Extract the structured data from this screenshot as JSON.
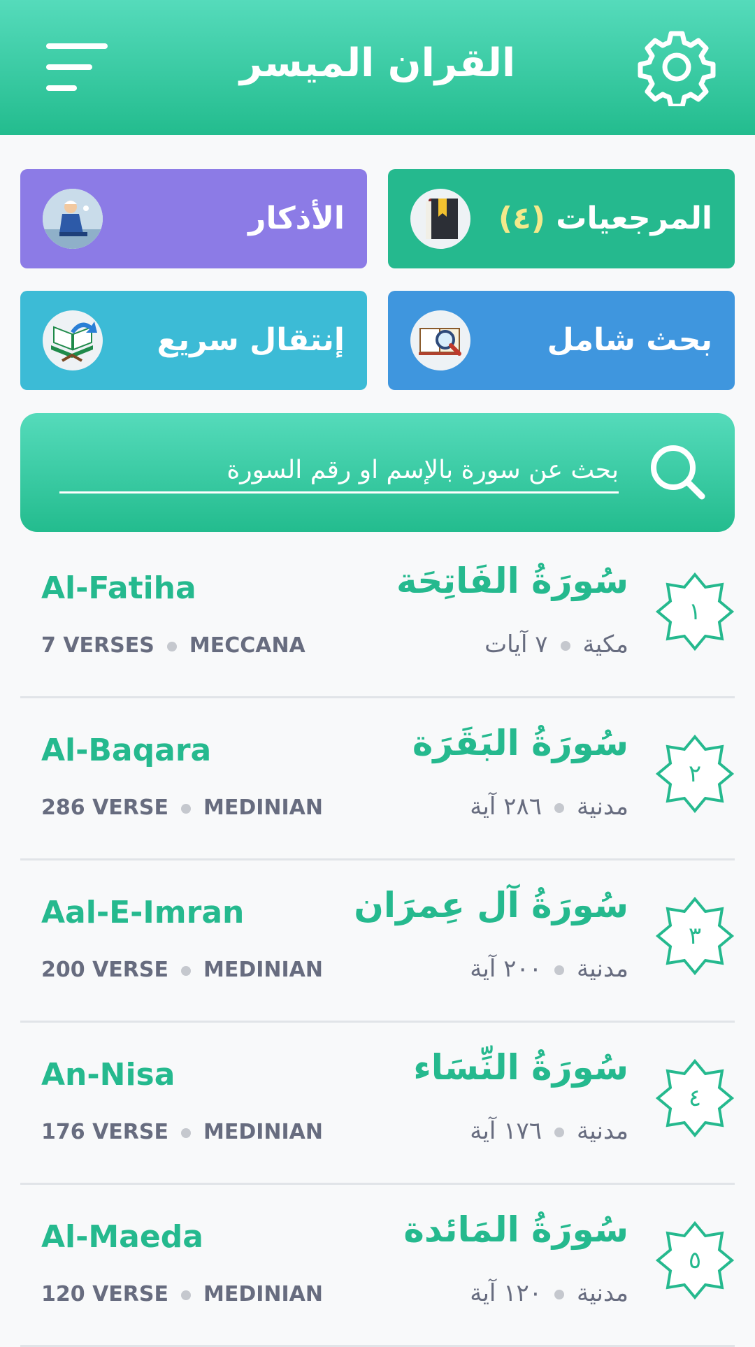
{
  "header": {
    "title": "القران الميسر"
  },
  "tiles": {
    "references": {
      "count": "(٤)",
      "label": "المرجعيات"
    },
    "adhkar": {
      "label": "الأذكار"
    },
    "comprehensive_search": {
      "label": "بحث شامل"
    },
    "quick_jump": {
      "label": "إنتقال سريع"
    }
  },
  "search": {
    "placeholder": "بحث عن سورة بالإسم او رقم السورة"
  },
  "surahs": [
    {
      "number": "١",
      "arabic": "سُورَةُ الفَاتِحَة",
      "english": "Al-Fatiha",
      "verses_en": "7 VERSES",
      "type_en": "MECCANA",
      "type_ar": "مكية",
      "verses_ar": "٧ آيات"
    },
    {
      "number": "٢",
      "arabic": "سُورَةُ البَقَرَة",
      "english": "Al-Baqara",
      "verses_en": "286 VERSE",
      "type_en": "MEDINIAN",
      "type_ar": "مدنية",
      "verses_ar": "٢٨٦ آية"
    },
    {
      "number": "٣",
      "arabic": "سُورَةُ آل عِمرَان",
      "english": "Aal-E-Imran",
      "verses_en": "200 VERSE",
      "type_en": "MEDINIAN",
      "type_ar": "مدنية",
      "verses_ar": "٢٠٠ آية"
    },
    {
      "number": "٤",
      "arabic": "سُورَةُ النِّسَاء",
      "english": "An-Nisa",
      "verses_en": "176 VERSE",
      "type_en": "MEDINIAN",
      "type_ar": "مدنية",
      "verses_ar": "١٧٦ آية"
    },
    {
      "number": "٥",
      "arabic": "سُورَةُ المَائدة",
      "english": "Al-Maeda",
      "verses_en": "120 VERSE",
      "type_en": "MEDINIAN",
      "type_ar": "مدنية",
      "verses_ar": "١٢٠ آية"
    }
  ],
  "colors": {
    "accent": "#25b98e",
    "header_top": "#55dbbb",
    "references_tile": "#25b98e",
    "adhkar_tile": "#8c7be6",
    "search_tile": "#3f96de",
    "jump_tile": "#3cbbd6",
    "meta_text": "#676c7f"
  },
  "icons": {
    "menu": "hamburger-menu-icon",
    "settings": "gear-icon",
    "references": "book-bookmark-icon",
    "adhkar": "praying-man-icon",
    "comprehensive_search": "book-magnifier-icon",
    "quick_jump": "quran-stand-arrow-icon",
    "search": "search-icon",
    "surah_number": "eight-point-star-icon"
  }
}
